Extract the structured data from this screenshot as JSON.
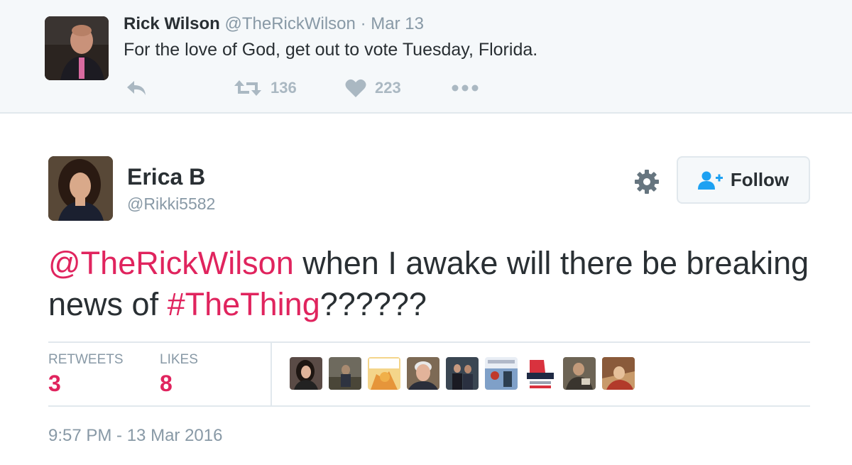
{
  "parent_tweet": {
    "name": "Rick Wilson",
    "handle": "@TheRickWilson",
    "separator": "·",
    "date": "Mar 13",
    "text": "For the love of God, get out to vote Tuesday, Florida.",
    "retweet_count": "136",
    "like_count": "223",
    "icons": [
      "reply-icon",
      "retweet-icon",
      "heart-icon",
      "more-icon"
    ]
  },
  "tweet": {
    "name": "Erica B",
    "handle": "@Rikki5582",
    "follow_label": "Follow",
    "text_parts": {
      "mention": "@TheRickWilson",
      "middle": " when I awake will there be breaking news of ",
      "hashtag": "#TheThing",
      "tail": "??????"
    },
    "stats": {
      "retweets_label": "RETWEETS",
      "retweets_value": "3",
      "likes_label": "LIKES",
      "likes_value": "8"
    },
    "timestamp": "9:57 PM - 13 Mar 2016"
  },
  "colors": {
    "accent": "#e0245e",
    "muted": "#8899a6",
    "icon": "#aab8c2",
    "text": "#292f33",
    "follow_icon": "#1da1f2"
  }
}
